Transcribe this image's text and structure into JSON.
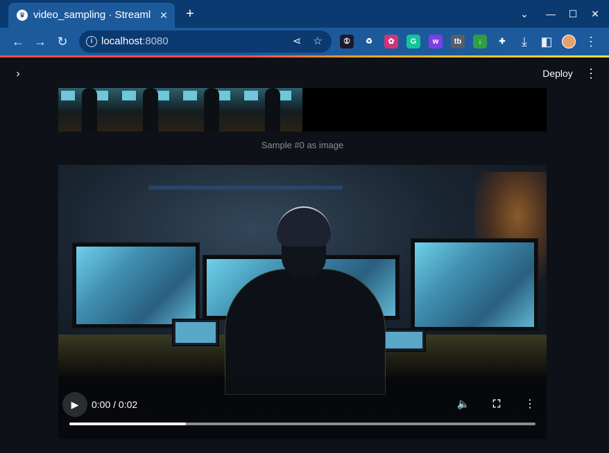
{
  "browser": {
    "tab_title": "video_sampling · Streamlit",
    "tab_favicon": "streamlit-crown-icon",
    "new_tab_label": "+",
    "url_host": "localhost",
    "url_port": ":8080",
    "window_controls": [
      "minimize",
      "maximize",
      "close"
    ],
    "extensions": [
      {
        "icon": "onepassword-icon",
        "color": "#1a1a2e",
        "glyph": "①"
      },
      {
        "icon": "recycle-icon",
        "color": "#1c5a9c",
        "glyph": "♻"
      },
      {
        "icon": "colorwheel-icon",
        "color": "#d0357a",
        "glyph": "✿"
      },
      {
        "icon": "grammarly-icon",
        "color": "#15c39a",
        "glyph": "G"
      },
      {
        "icon": "wallet-icon",
        "color": "#7b3fe4",
        "glyph": "w"
      },
      {
        "icon": "tb-icon",
        "color": "#555e6a",
        "glyph": "tb"
      },
      {
        "icon": "download-green-icon",
        "color": "#2f9e44",
        "glyph": "↓"
      },
      {
        "icon": "puzzle-icon",
        "color": "transparent",
        "glyph": "✚"
      }
    ]
  },
  "app": {
    "deploy_label": "Deploy",
    "caption": "Sample #0 as image"
  },
  "video": {
    "time": "0:00 / 0:02",
    "progress": 0.25
  },
  "colors": {
    "accent_start": "#ff4b4b",
    "accent_end": "#f7e245",
    "app_bg": "#0e1117",
    "chrome": "#1c5a9c"
  }
}
